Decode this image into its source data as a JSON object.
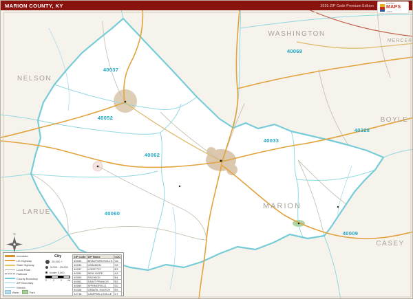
{
  "header": {
    "title": "MARION COUNTY, KY",
    "edition": "2020 ZIP Code Premium Edition"
  },
  "logo": {
    "top": "market",
    "main": "MAPS",
    "suffix": ".com"
  },
  "map": {
    "county_labels": [
      {
        "text": "NELSON"
      },
      {
        "text": "WASHINGTON"
      },
      {
        "text": "MERCER"
      },
      {
        "text": "BOYLE"
      },
      {
        "text": "LARUE"
      },
      {
        "text": "MARION"
      },
      {
        "text": "CASEY"
      }
    ],
    "zip_labels": [
      {
        "text": "40037"
      },
      {
        "text": "40052"
      },
      {
        "text": "40062"
      },
      {
        "text": "40069"
      },
      {
        "text": "40033"
      },
      {
        "text": "40328"
      },
      {
        "text": "40060"
      },
      {
        "text": "40009"
      }
    ],
    "compass": {
      "north": "N"
    }
  },
  "legend": {
    "lines": [
      {
        "label": "Interstate"
      },
      {
        "label": "US Highway"
      },
      {
        "label": "State Highway"
      },
      {
        "label": "Local Road"
      },
      {
        "label": "Railroad"
      },
      {
        "label": "County Boundary"
      },
      {
        "label": "ZIP Boundary"
      },
      {
        "label": "Stream"
      }
    ],
    "areas": [
      {
        "label": "Water"
      },
      {
        "label": "Park"
      }
    ],
    "city": {
      "title": "City",
      "sizes": [
        {
          "label": "25,000 +"
        },
        {
          "label": "5,000 - 25,000"
        },
        {
          "label": "Under 5,000"
        }
      ]
    },
    "scale": {
      "start": "0",
      "mid": "2",
      "end": "4",
      "unit": "mi"
    },
    "table": {
      "headers": [
        "ZIP Code",
        "ZIP Name",
        "LOC"
      ],
      "rows": [
        [
          "40009",
          "BRADFORDSVILLE",
          "C6"
        ],
        [
          "40033",
          "LEBANON",
          "C5"
        ],
        [
          "40037",
          "LORETTO",
          "B3"
        ],
        [
          "40052",
          "NEW HOPE",
          "A3"
        ],
        [
          "40060",
          "RAYWICK",
          "B4"
        ],
        [
          "40062",
          "SAINT FRANCIS",
          "B3"
        ],
        [
          "40069",
          "SPRINGFIELD",
          "D2"
        ],
        [
          "40328",
          "GRAVEL SWITCH",
          "E5"
        ],
        [
          "42718",
          "CAMPBELLSVILLE",
          "C7"
        ]
      ]
    }
  },
  "colors": {
    "header_bg": "#8a1310",
    "boundary_cyan": "#76ccd8",
    "zip_label_cyan": "#1ba7c4",
    "road_orange": "#e2a23c",
    "urban_tan": "#d8c2a4"
  }
}
